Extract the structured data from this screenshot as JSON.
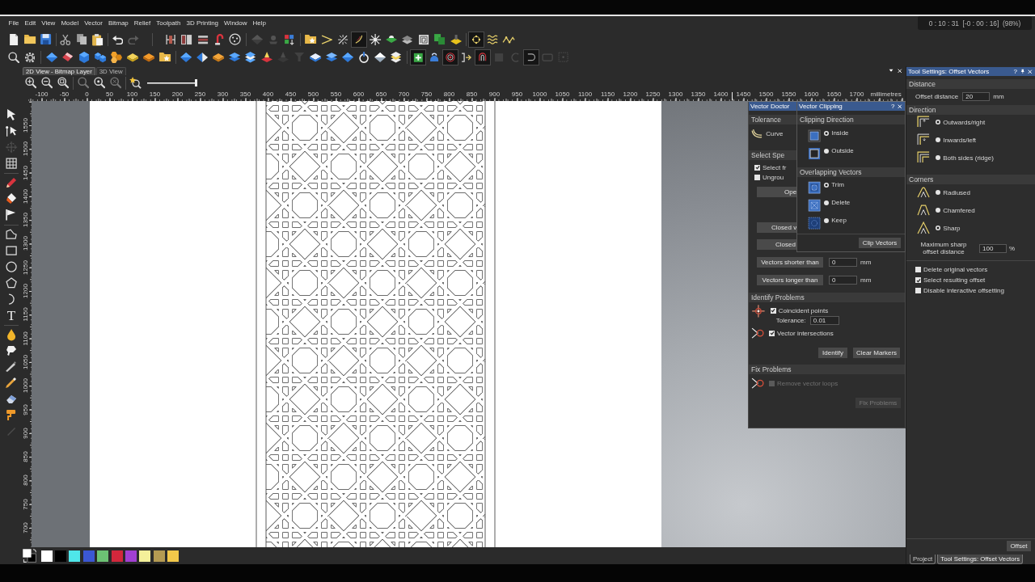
{
  "recording_overlay": {
    "timer": "0 : 10 : 31  [-0 : 00 : 16]  (98%)"
  },
  "menu_bar": [
    "File",
    "Edit",
    "View",
    "Model",
    "Vector",
    "Bitmap",
    "Relief",
    "Toolpath",
    "3D Printing",
    "Window",
    "Help"
  ],
  "toolbar_1": [
    [
      {
        "selected": false,
        "disabled": false
      },
      {
        "selected": false,
        "disabled": false
      },
      {
        "selected": false,
        "disabled": false
      }
    ],
    [
      {
        "selected": false,
        "disabled": false
      },
      {
        "selected": false,
        "disabled": false
      },
      {
        "selected": false,
        "disabled": false
      }
    ],
    [
      {
        "selected": false,
        "disabled": false
      },
      {
        "selected": false,
        "disabled": true
      }
    ],
    [
      {
        "selected": false,
        "disabled": false
      },
      {
        "selected": false,
        "disabled": false
      },
      {
        "selected": false,
        "disabled": false
      },
      {
        "selected": false,
        "disabled": false
      },
      {
        "selected": false,
        "disabled": false
      }
    ],
    [
      {
        "selected": false,
        "disabled": true
      },
      {
        "selected": false,
        "disabled": true
      },
      {
        "selected": false,
        "disabled": false
      }
    ],
    [
      {
        "selected": false,
        "disabled": false
      },
      {
        "selected": false,
        "disabled": false
      },
      {
        "selected": false,
        "disabled": false
      },
      {
        "selected": true,
        "disabled": false
      },
      {
        "selected": false,
        "disabled": false
      },
      {
        "selected": false,
        "disabled": false
      },
      {
        "selected": false,
        "disabled": false
      },
      {
        "selected": false,
        "disabled": false
      },
      {
        "selected": false,
        "disabled": false
      },
      {
        "selected": false,
        "disabled": false
      }
    ],
    [
      {
        "selected": true,
        "disabled": false
      },
      {
        "selected": false,
        "disabled": false
      },
      {
        "selected": false,
        "disabled": false
      }
    ]
  ],
  "toolbar_2": [
    [
      {
        "selected": false,
        "disabled": false
      },
      {
        "selected": false,
        "disabled": false
      }
    ],
    [
      {
        "selected": false,
        "disabled": false
      },
      {
        "selected": false,
        "disabled": false
      },
      {
        "selected": false,
        "disabled": false
      },
      {
        "selected": false,
        "disabled": false
      },
      {
        "selected": false,
        "disabled": false
      },
      {
        "selected": false,
        "disabled": false
      },
      {
        "selected": false,
        "disabled": false
      },
      {
        "selected": false,
        "disabled": false
      }
    ],
    [
      {
        "selected": false,
        "disabled": false
      },
      {
        "selected": false,
        "disabled": false
      },
      {
        "selected": false,
        "disabled": false
      },
      {
        "selected": false,
        "disabled": false
      },
      {
        "selected": false,
        "disabled": false
      },
      {
        "selected": false,
        "disabled": false
      },
      {
        "selected": false,
        "disabled": true
      },
      {
        "selected": false,
        "disabled": true
      },
      {
        "selected": false,
        "disabled": false
      },
      {
        "selected": false,
        "disabled": false
      },
      {
        "selected": false,
        "disabled": false
      },
      {
        "selected": false,
        "disabled": false
      },
      {
        "selected": false,
        "disabled": false
      },
      {
        "selected": false,
        "disabled": false
      }
    ],
    [
      {
        "selected": true,
        "disabled": false
      },
      {
        "selected": false,
        "disabled": false
      },
      {
        "selected": true,
        "disabled": false
      },
      {
        "selected": false,
        "disabled": false
      },
      {
        "selected": true,
        "disabled": false
      },
      {
        "selected": false,
        "disabled": true
      },
      {
        "selected": false,
        "disabled": true
      },
      {
        "selected": true,
        "disabled": false
      },
      {
        "selected": false,
        "disabled": true
      },
      {
        "selected": false,
        "disabled": true
      }
    ]
  ],
  "view_tabs": [
    {
      "label": "2D View - Bitmap Layer",
      "selected": true
    },
    {
      "label": "3D View",
      "selected": false
    }
  ],
  "view_toolbar": {
    "groups": [
      [
        {
          "selected": false,
          "disabled": false
        },
        {
          "selected": false,
          "disabled": false
        },
        {
          "selected": false,
          "disabled": false
        }
      ],
      [
        {
          "selected": false,
          "disabled": true
        },
        {
          "selected": false,
          "disabled": false
        },
        {
          "selected": false,
          "disabled": true
        }
      ],
      [
        {
          "selected": false,
          "disabled": false
        }
      ]
    ],
    "zoom_slider": {
      "level": 1
    }
  },
  "rulers": {
    "horizontal": [
      "-100",
      "-50",
      "0",
      "50",
      "100",
      "150",
      "200",
      "250",
      "300",
      "350",
      "400",
      "450",
      "500",
      "550",
      "600",
      "650",
      "700",
      "750",
      "800",
      "850",
      "900",
      "950",
      "1000",
      "1050",
      "1100",
      "1150",
      "1200",
      "1250",
      "1300",
      "1350",
      "1400",
      "1450",
      "1500",
      "1550",
      "1600",
      "1650",
      "1700"
    ],
    "unit": "millimetres",
    "vertical": [
      "1550",
      "1500",
      "1450",
      "1400",
      "1350",
      "1300",
      "1250",
      "1200",
      "1150",
      "1100",
      "1050",
      "1000",
      "950",
      "900",
      "850",
      "800",
      "750",
      "700"
    ]
  },
  "tool_column": [
    [
      {
        "disabled": false
      },
      {
        "disabled": false
      },
      {
        "disabled": true
      },
      {
        "disabled": false
      }
    ],
    [
      {
        "disabled": false
      },
      {
        "disabled": false
      },
      {
        "disabled": false
      }
    ],
    [
      {
        "disabled": false
      },
      {
        "disabled": false
      },
      {
        "disabled": false
      },
      {
        "disabled": false
      },
      {
        "disabled": false
      },
      {
        "glyph": "T",
        "disabled": false
      }
    ],
    [
      {
        "disabled": false
      },
      {
        "disabled": false
      },
      {
        "disabled": false
      },
      {
        "disabled": false
      },
      {
        "disabled": false
      },
      {
        "disabled": false
      },
      {
        "disabled": true
      }
    ]
  ],
  "vector_doctor": {
    "title": "Vector Doctor",
    "tolerance": {
      "header": "Tolerance",
      "label": "Curve"
    },
    "select_specific": {
      "header": "Select Spe",
      "checkboxes": [
        {
          "label": "Select fr",
          "checked": true
        },
        {
          "label": "Ungrou",
          "checked": false
        }
      ],
      "buttons": [
        "Ope",
        "Closed v",
        "Closed"
      ],
      "length_filters": [
        {
          "button": "Vectors shorter than",
          "value": "0",
          "unit": "mm"
        },
        {
          "button": "Vectors longer than",
          "value": "0",
          "unit": "mm"
        }
      ]
    },
    "identify_problems": {
      "header": "Identify Problems",
      "coincident": {
        "label": "Coincident points",
        "checked": true,
        "tolerance_label": "Tolerance:",
        "tolerance_value": "0.01"
      },
      "intersections": {
        "label": "Vector intersections",
        "checked": true
      },
      "buttons": [
        "Identify",
        "Clear Markers"
      ]
    },
    "fix_problems": {
      "header": "Fix Problems",
      "loops": {
        "label": "Remove vector loops",
        "checked": false,
        "disabled": true
      },
      "button": {
        "label": "Fix Problems",
        "disabled": true
      }
    }
  },
  "vector_clipping": {
    "title": "Vector Clipping",
    "help": "?",
    "clipping_direction": {
      "header": "Clipping Direction",
      "options": [
        {
          "label": "Inside",
          "selected": true
        },
        {
          "label": "Outside",
          "selected": false
        }
      ]
    },
    "overlapping_vectors": {
      "header": "Overlapping Vectors",
      "options": [
        {
          "label": "Trim",
          "selected": true
        },
        {
          "label": "Delete",
          "selected": false
        },
        {
          "label": "Keep",
          "selected": false
        }
      ]
    },
    "button": "Clip Vectors"
  },
  "palette": [
    {
      "color": "#ffffff"
    },
    {
      "color": "#000000"
    },
    {
      "color": "#4fe6ea"
    },
    {
      "color": "#3b57d4"
    },
    {
      "color": "#6cc274"
    },
    {
      "color": "#d2273c"
    },
    {
      "color": "#a23fd2"
    },
    {
      "color": "#f4f09a"
    },
    {
      "color": "#b49a52"
    },
    {
      "color": "#f2c84a"
    }
  ],
  "tool_settings": {
    "title": "Tool Settings: Offset Vectors",
    "help": "?",
    "distance": {
      "header": "Distance",
      "label": "Offset distance",
      "value": "20",
      "unit": "mm"
    },
    "direction": {
      "header": "Direction",
      "options": [
        {
          "label": "Outwards/right",
          "selected": true
        },
        {
          "label": "Inwards/left",
          "selected": false
        },
        {
          "label": "Both sides (ridge)",
          "selected": false
        }
      ]
    },
    "corners": {
      "header": "Corners",
      "options": [
        {
          "label": "Radiused",
          "selected": false
        },
        {
          "label": "Chamfered",
          "selected": false
        },
        {
          "label": "Sharp",
          "selected": true
        }
      ],
      "max_sharp": {
        "label": "Maximum sharp offset distance",
        "value": "100",
        "unit": "%"
      }
    },
    "options": [
      {
        "label": "Delete original vectors",
        "checked": false
      },
      {
        "label": "Select resulting offset",
        "checked": true
      },
      {
        "label": "Disable interactive offsetting",
        "checked": false
      }
    ],
    "button": "Offset"
  },
  "bottom_tabs": [
    {
      "label": "Project",
      "selected": false
    },
    {
      "label": "Tool Settings: Offset Vectors",
      "selected": true
    }
  ]
}
